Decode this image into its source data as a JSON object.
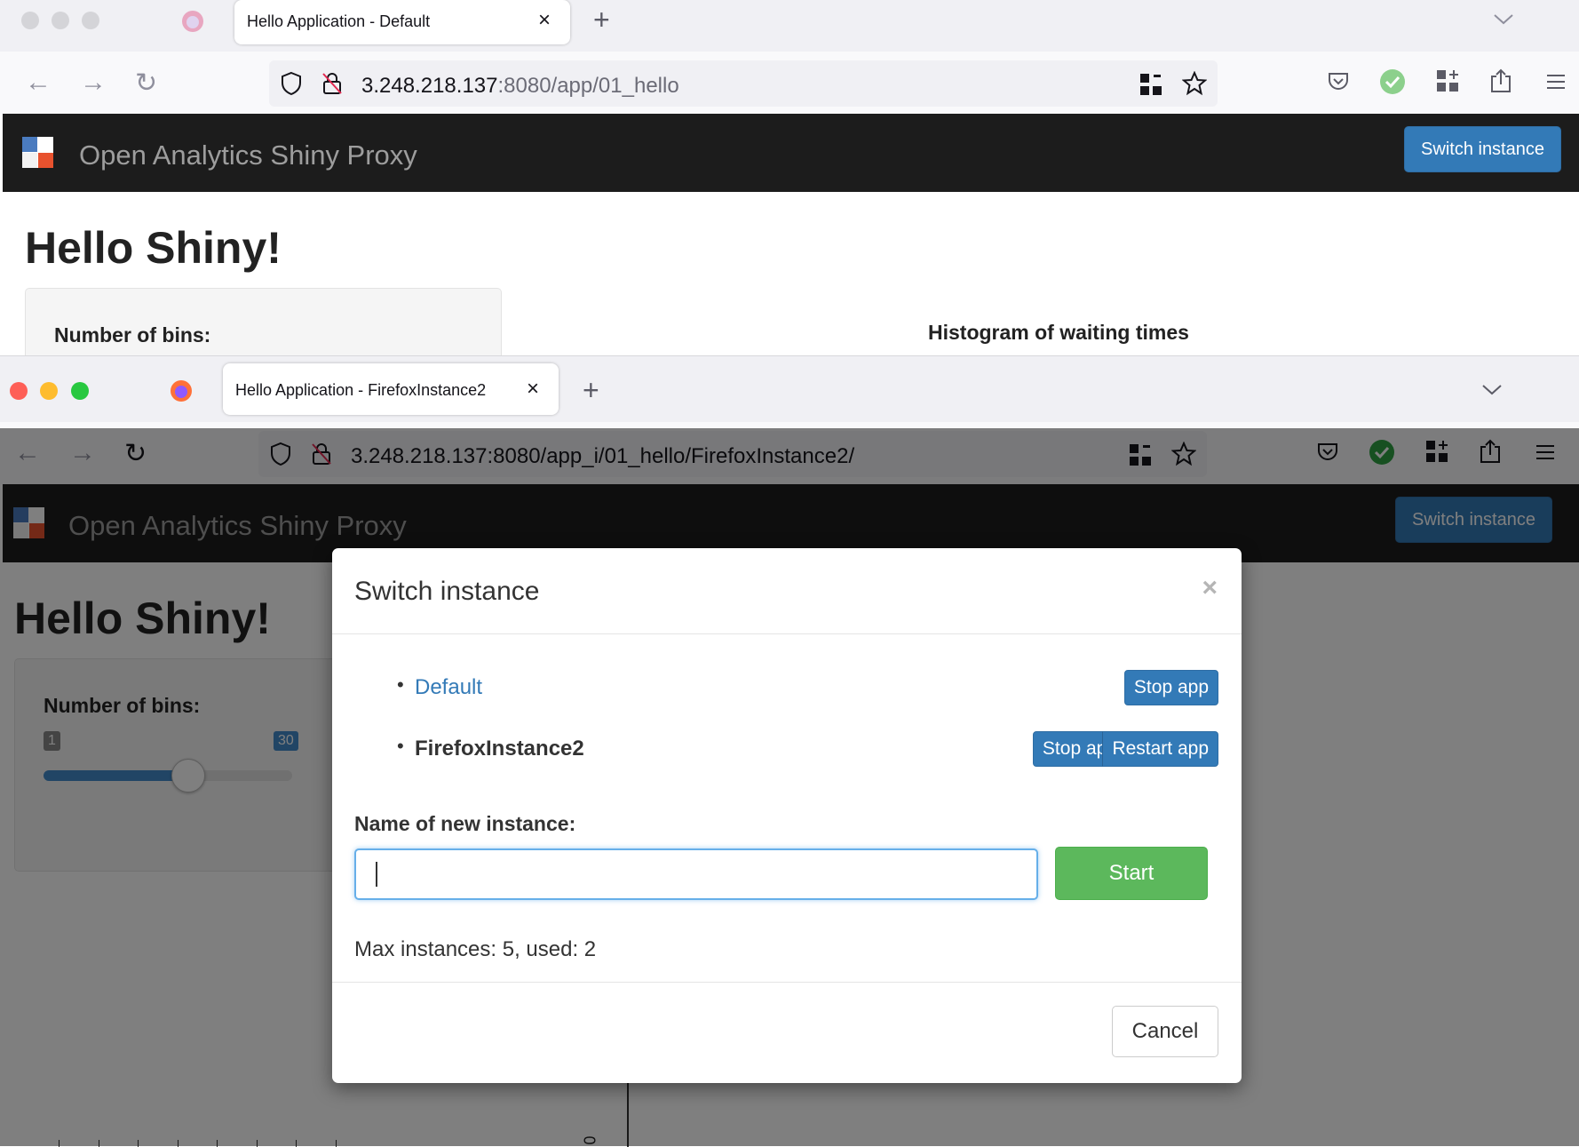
{
  "window1": {
    "tab_title": "Hello Application - Default",
    "url_host": "3.248.218.137",
    "url_rest": ":8080/app/01_hello",
    "brand": "Open Analytics Shiny Proxy",
    "switch_label": "Switch instance",
    "page_title": "Hello Shiny!",
    "bins_label": "Number of bins:",
    "histogram_title": "Histogram of waiting times"
  },
  "window2": {
    "tab_title": "Hello Application - FirefoxInstance2",
    "url_host": "3.248.218.137",
    "url_rest": ":8080/app_i/01_hello/FirefoxInstance2/",
    "brand": "Open Analytics Shiny Proxy",
    "switch_label": "Switch instance",
    "page_title": "Hello Shiny!",
    "bins_label": "Number of bins:",
    "slider": {
      "min_label": "1",
      "value_label": "30",
      "value_fraction": 0.58,
      "ticks": [
        "1",
        "6",
        "11",
        "16",
        "21",
        "26",
        "31",
        "3"
      ]
    },
    "plot_axis_zero": "0"
  },
  "modal": {
    "title": "Switch instance",
    "close_glyph": "×",
    "instances": [
      {
        "name": "Default",
        "is_current": false,
        "buttons": [
          "Stop app"
        ]
      },
      {
        "name": "FirefoxInstance2",
        "is_current": true,
        "buttons": [
          "Stop app",
          "Restart app"
        ]
      }
    ],
    "new_instance_label": "Name of new instance:",
    "input_value": "",
    "start_label": "Start",
    "max_text": "Max instances: 5, used: 2",
    "cancel_label": "Cancel"
  },
  "colors": {
    "primary": "#337ab7",
    "success": "#5cb85c",
    "navbar": "#1c1c1c",
    "link": "#337ab7"
  }
}
